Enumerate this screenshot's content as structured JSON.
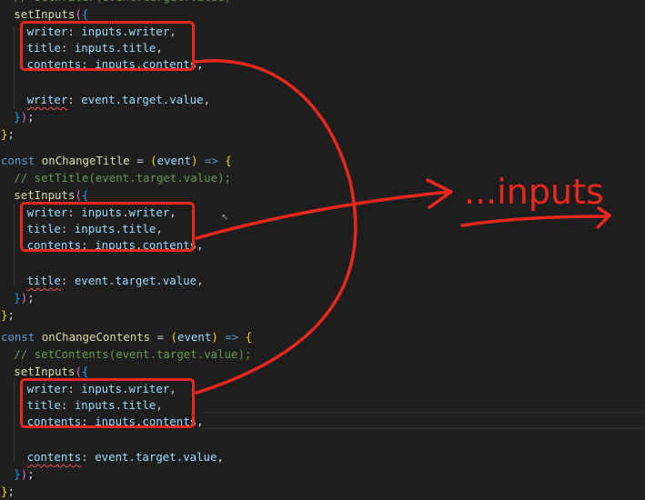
{
  "editor": {
    "blocks": [
      {
        "comment": "// setWriter(event.target.value)",
        "call": "setInputs",
        "fields": [
          {
            "key": "writer",
            "obj": "inputs",
            "prop": "writer"
          },
          {
            "key": "title",
            "obj": "inputs",
            "prop": "title"
          },
          {
            "key": "contents",
            "obj": "inputs",
            "prop": "contents"
          }
        ],
        "override_key": "writer",
        "override_value": "event.target.value"
      },
      {
        "decl": "const",
        "name": "onChangeTitle",
        "param": "event",
        "comment": "// setTitle(event.target.value);",
        "call": "setInputs",
        "fields": [
          {
            "key": "writer",
            "obj": "inputs",
            "prop": "writer"
          },
          {
            "key": "title",
            "obj": "inputs",
            "prop": "title"
          },
          {
            "key": "contents",
            "obj": "inputs",
            "prop": "contents"
          }
        ],
        "override_key": "title",
        "override_value": "event.target.value"
      },
      {
        "decl": "const",
        "name": "onChangeContents",
        "param": "event",
        "comment": "// setContents(event.target.value);",
        "call": "setInputs",
        "fields": [
          {
            "key": "writer",
            "obj": "inputs",
            "prop": "writer"
          },
          {
            "key": "title",
            "obj": "inputs",
            "prop": "title"
          },
          {
            "key": "contents",
            "obj": "inputs",
            "prop": "contents"
          }
        ],
        "override_key": "contents",
        "override_value": "event.target.value"
      }
    ]
  },
  "annotation": {
    "note": "...inputs",
    "color": "#e8271d"
  },
  "colors": {
    "background": "#1e1e1e",
    "keyword": "#569cd6",
    "function": "#dcdcaa",
    "variable": "#9cdcfe",
    "comment": "#6a9955"
  }
}
